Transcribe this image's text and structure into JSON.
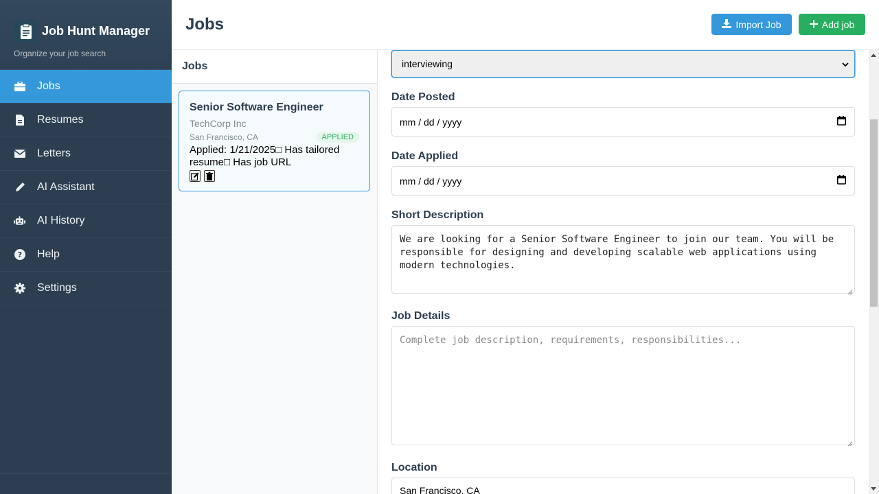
{
  "app": {
    "title": "Job Hunt Manager",
    "subtitle": "Organize your job search",
    "logo_icon": "clipboard-document-icon"
  },
  "sidebar": {
    "items": [
      {
        "label": "Jobs",
        "icon": "briefcase-icon",
        "active": true
      },
      {
        "label": "Resumes",
        "icon": "file-icon"
      },
      {
        "label": "Letters",
        "icon": "envelope-icon"
      },
      {
        "label": "AI Assistant",
        "icon": "pencil-icon"
      },
      {
        "label": "AI History",
        "icon": "robot-icon"
      },
      {
        "label": "Help",
        "icon": "question-circle-icon"
      },
      {
        "label": "Settings",
        "icon": "gear-icon"
      }
    ]
  },
  "header": {
    "title": "Jobs",
    "import_label": "Import Job",
    "add_label": "Add job"
  },
  "jobs_list": {
    "heading": "Jobs",
    "jobs": [
      {
        "title": "Senior Software Engineer",
        "company": "TechCorp Inc",
        "location": "San Francisco, CA",
        "status": "APPLIED",
        "meta": "Applied: 1/21/2025□ Has tailored resume□ Has job URL"
      }
    ]
  },
  "form": {
    "status_value": "interviewing",
    "date_posted_label": "Date Posted",
    "date_posted_value": "mm / dd / yyyy",
    "date_applied_label": "Date Applied",
    "date_applied_value": "mm / dd / yyyy",
    "short_desc_label": "Short Description",
    "short_desc_value": "We are looking for a Senior Software Engineer to join our team. You will be responsible for designing and developing scalable web applications using modern technologies.",
    "job_details_label": "Job Details",
    "job_details_placeholder": "Complete job description, requirements, responsibilities...",
    "location_label": "Location",
    "location_value": "San Francisco, CA"
  },
  "colors": {
    "sidebar_bg": "#2c3e50",
    "accent": "#3498db",
    "success": "#27ae60"
  }
}
